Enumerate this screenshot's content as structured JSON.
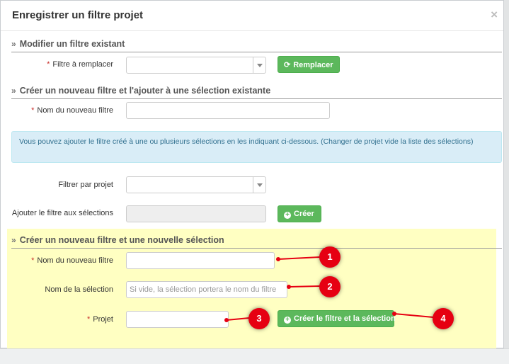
{
  "modal": {
    "title": "Enregistrer un filtre projet",
    "close": "×"
  },
  "section_modify": {
    "title": "Modifier un filtre existant",
    "filter_to_replace_label": "Filtre à remplacer",
    "replace_button": "Remplacer"
  },
  "section_existing": {
    "title": "Créer un nouveau filtre et l'ajouter à une sélection existante",
    "new_filter_name_label": "Nom du nouveau filtre",
    "info_text": "Vous pouvez ajouter le filtre créé à une ou plusieurs sélections en les indiquant ci-dessous. (Changer de projet vide la liste des sélections)",
    "filter_by_project_label": "Filtrer par projet",
    "add_to_selections_label": "Ajouter le filtre aux sélections",
    "create_button": "Créer"
  },
  "section_new": {
    "title": "Créer un nouveau filtre et une nouvelle sélection",
    "new_filter_name_label": "Nom du nouveau filtre",
    "selection_name_label": "Nom de la sélection",
    "selection_name_placeholder": "Si vide, la sélection portera le nom du filtre",
    "project_label": "Projet",
    "create_both_button": "Créer le filtre et la sélection"
  },
  "required_mark": "*",
  "annotations": [
    "1",
    "2",
    "3",
    "4"
  ],
  "colors": {
    "success": "#5cb85c",
    "info_bg": "#d9edf7",
    "highlight": "#ffffc2",
    "marker": "#e60012"
  }
}
